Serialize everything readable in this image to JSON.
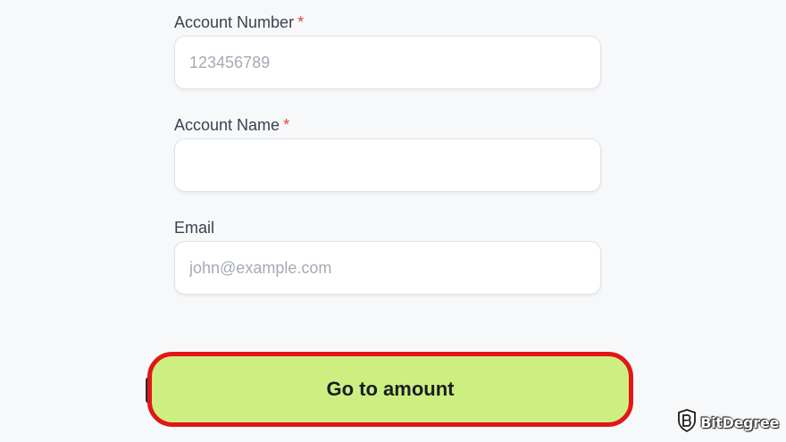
{
  "form": {
    "account_number": {
      "label": "Account Number",
      "required_mark": "*",
      "placeholder": "123456789",
      "value": ""
    },
    "account_name": {
      "label": "Account Name",
      "required_mark": "*",
      "placeholder": "",
      "value": ""
    },
    "email": {
      "label": "Email",
      "placeholder": "john@example.com",
      "value": ""
    }
  },
  "submit_button": {
    "label": "Go to amount"
  },
  "watermark": {
    "text": "BitDegree",
    "icon": "bitdegree-shield-logo"
  },
  "colors": {
    "background": "#f7f8fa",
    "button_fill": "#cdef82",
    "highlight_border": "#e21616",
    "required_asterisk": "#e0463f",
    "placeholder_text": "#a4aab4"
  }
}
